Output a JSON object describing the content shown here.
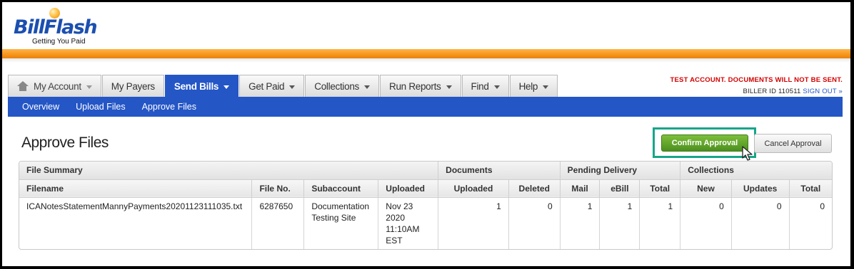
{
  "brand": {
    "name": "BillFlash",
    "tagline": "Getting You Paid"
  },
  "nav": {
    "tabs": [
      {
        "label": "My Account"
      },
      {
        "label": "My Payers"
      },
      {
        "label": "Send Bills"
      },
      {
        "label": "Get Paid"
      },
      {
        "label": "Collections"
      },
      {
        "label": "Run Reports"
      },
      {
        "label": "Find"
      },
      {
        "label": "Help"
      }
    ],
    "subnav": [
      {
        "label": "Overview"
      },
      {
        "label": "Upload Files"
      },
      {
        "label": "Approve Files"
      }
    ]
  },
  "account": {
    "notice": "TEST ACCOUNT. DOCUMENTS WILL NOT BE SENT.",
    "biller_id_label": "BILLER ID 110511",
    "sign_out": "SIGN OUT »"
  },
  "page": {
    "title": "Approve Files",
    "confirm_button": "Confirm Approval",
    "cancel_button": "Cancel Approval"
  },
  "table": {
    "group_headers": {
      "file_summary": "File Summary",
      "documents": "Documents",
      "pending_delivery": "Pending Delivery",
      "collections": "Collections"
    },
    "columns": {
      "filename": "Filename",
      "file_no": "File No.",
      "subaccount": "Subaccount",
      "uploaded": "Uploaded",
      "doc_uploaded": "Uploaded",
      "doc_deleted": "Deleted",
      "mail": "Mail",
      "ebill": "eBill",
      "pd_total": "Total",
      "new": "New",
      "updates": "Updates",
      "col_total": "Total"
    },
    "rows": [
      {
        "filename": "ICANotesStatementMannyPayments20201123111035.txt",
        "file_no": "6287650",
        "subaccount_line1": "Documentation",
        "subaccount_line2": "Testing Site",
        "uploaded_line1": "Nov 23",
        "uploaded_line2": "2020",
        "uploaded_line3": "11:10AM",
        "uploaded_line4": "EST",
        "doc_uploaded": "1",
        "doc_deleted": "0",
        "mail": "1",
        "ebill": "1",
        "pd_total": "1",
        "new": "0",
        "updates": "0",
        "col_total": "0"
      }
    ]
  },
  "colors": {
    "brand_blue": "#2456c6",
    "accent_orange": "#f7941d",
    "confirm_green": "#5fa52a",
    "highlight_teal": "#17a589",
    "notice_red": "#d40000"
  }
}
